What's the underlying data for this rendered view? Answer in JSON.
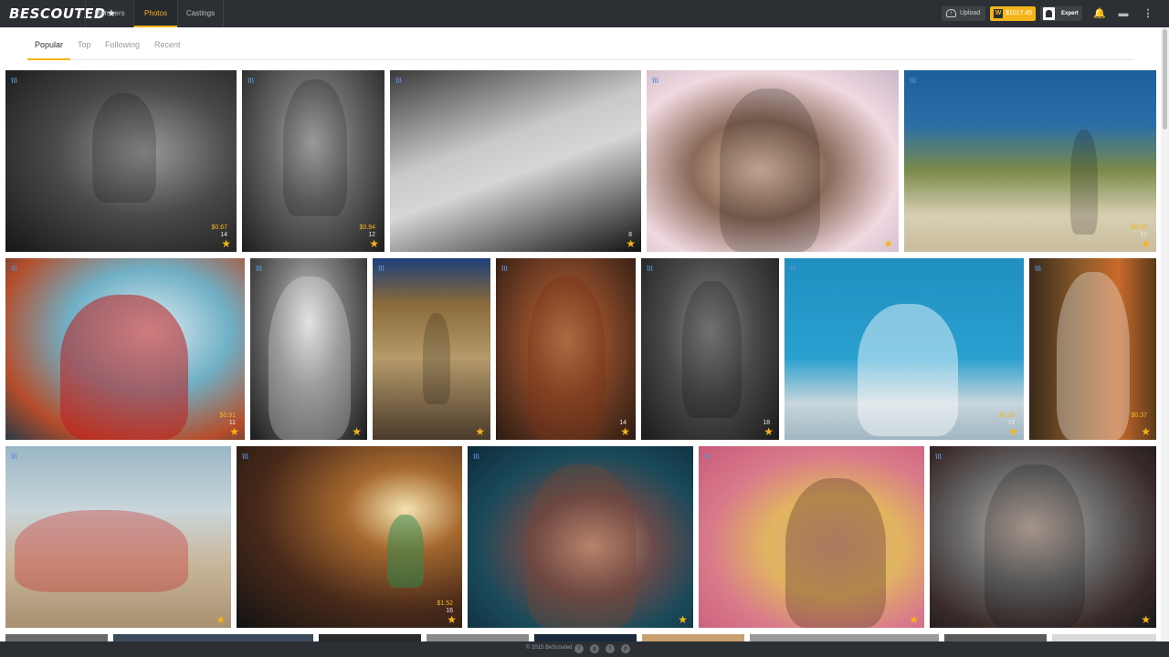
{
  "header": {
    "logo": "BESCOUTED",
    "nav": [
      {
        "label": "Members"
      },
      {
        "label": "Photos"
      },
      {
        "label": "Castings"
      }
    ],
    "upload_label": "Upload",
    "balance": "$1017.45",
    "expert_label": "Expert"
  },
  "subtabs": [
    {
      "label": "Popular"
    },
    {
      "label": "Top"
    },
    {
      "label": "Following"
    },
    {
      "label": "Recent"
    }
  ],
  "photos": [
    {
      "price": "$0.67",
      "votes": "14"
    },
    {
      "price": "$0.94",
      "votes": "12"
    },
    {
      "price": "",
      "votes": "8"
    },
    {
      "price": "",
      "votes": ""
    },
    {
      "price": "$0.55",
      "votes": "13"
    },
    {
      "price": "$0.91",
      "votes": "11"
    },
    {
      "price": "",
      "votes": ""
    },
    {
      "price": "",
      "votes": ""
    },
    {
      "price": "",
      "votes": "14"
    },
    {
      "price": "",
      "votes": "18"
    },
    {
      "price": "$0.35",
      "votes": "19"
    },
    {
      "price": "$0.37",
      "votes": ""
    },
    {
      "price": "",
      "votes": ""
    },
    {
      "price": "$1.52",
      "votes": "16"
    },
    {
      "price": "",
      "votes": ""
    },
    {
      "price": "",
      "votes": ""
    },
    {
      "price": "",
      "votes": ""
    }
  ],
  "footer": {
    "copyright": "© 2015 BeScouted"
  },
  "colors": {
    "accent": "#f4b41a",
    "topbar": "#2c2f33"
  },
  "icons": [
    "upload-icon",
    "steem-icon",
    "expert-icon",
    "bell-icon",
    "chat-icon",
    "more-icon",
    "star-icon",
    "facebook-icon",
    "googleplus-icon",
    "twitter-icon",
    "pinterest-icon"
  ]
}
